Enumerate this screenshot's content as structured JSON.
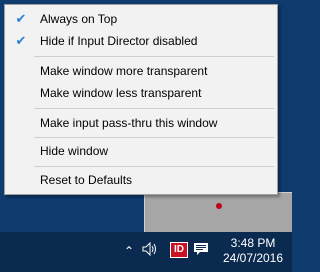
{
  "menu": {
    "items": [
      {
        "label": "Always on Top",
        "checked": true
      },
      {
        "label": "Hide if Input Director disabled",
        "checked": true
      },
      {
        "label": "Make window more transparent",
        "checked": false
      },
      {
        "label": "Make window less transparent",
        "checked": false
      },
      {
        "label": "Make input pass-thru this window",
        "checked": false
      },
      {
        "label": "Hide window",
        "checked": false
      },
      {
        "label": "Reset to Defaults",
        "checked": false
      }
    ]
  },
  "taskbar": {
    "id_badge": "ID",
    "time": "3:48 PM",
    "date": "24/07/2016"
  },
  "icons": {
    "check": "checkmark-icon",
    "overflow": "chevron-up-icon",
    "volume": "speaker-icon",
    "notifications": "action-center-icon",
    "app": "input-director-icon"
  },
  "colors": {
    "check": "#2a7fd4",
    "menu_bg": "#f2f2f2",
    "desktop": "#0f3b6e",
    "taskbar": "#0a2a4f",
    "badge": "#cc1122"
  }
}
